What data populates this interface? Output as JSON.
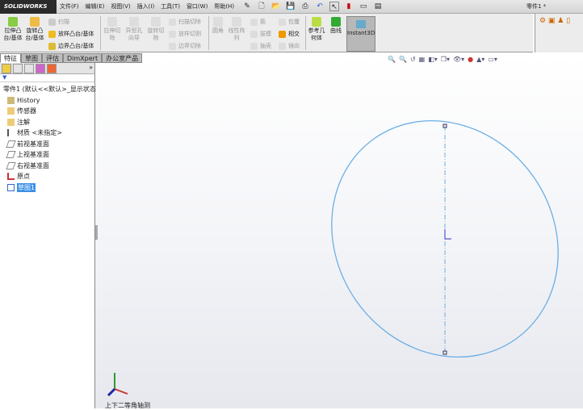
{
  "app": {
    "logo": "SOLIDWORKS",
    "title": "零件1 *"
  },
  "menu": [
    "文件(F)",
    "编辑(E)",
    "视图(V)",
    "插入(I)",
    "工具(T)",
    "窗口(W)",
    "帮助(H)"
  ],
  "ribbon": {
    "extrude_boss": "拉伸凸台/基体",
    "revolve_boss": "旋转凸台/基体",
    "sweep": "扫描",
    "loft": "放样凸台/基体",
    "boundary": "边界凸台/基体",
    "extrude_cut": "拉伸切除",
    "hole_wizard": "异型孔向导",
    "revolve_cut": "旋转切除",
    "sweep_cut": "扫描切除",
    "loft_cut": "放样切割",
    "boundary_cut": "边界切除",
    "fillet": "圆角",
    "linear_pattern": "线性阵列",
    "rib": "筋",
    "draft": "拔模",
    "shell": "抽壳",
    "wrap": "包覆",
    "intersect": "相交",
    "mirror": "镜向",
    "ref_geometry": "参考几何体",
    "curves": "曲线",
    "instant3d": "Instant3D"
  },
  "tabs": [
    "特征",
    "草图",
    "评估",
    "DimXpert",
    "办公室产品"
  ],
  "tree": {
    "root": "零件1 (默认<<默认>_显示状态",
    "items": [
      "History",
      "传感器",
      "注解",
      "材质 <未指定>",
      "前视基准面",
      "上视基准面",
      "右视基准面",
      "原点",
      "草图1"
    ]
  },
  "view_label": "上下二等角轴测"
}
